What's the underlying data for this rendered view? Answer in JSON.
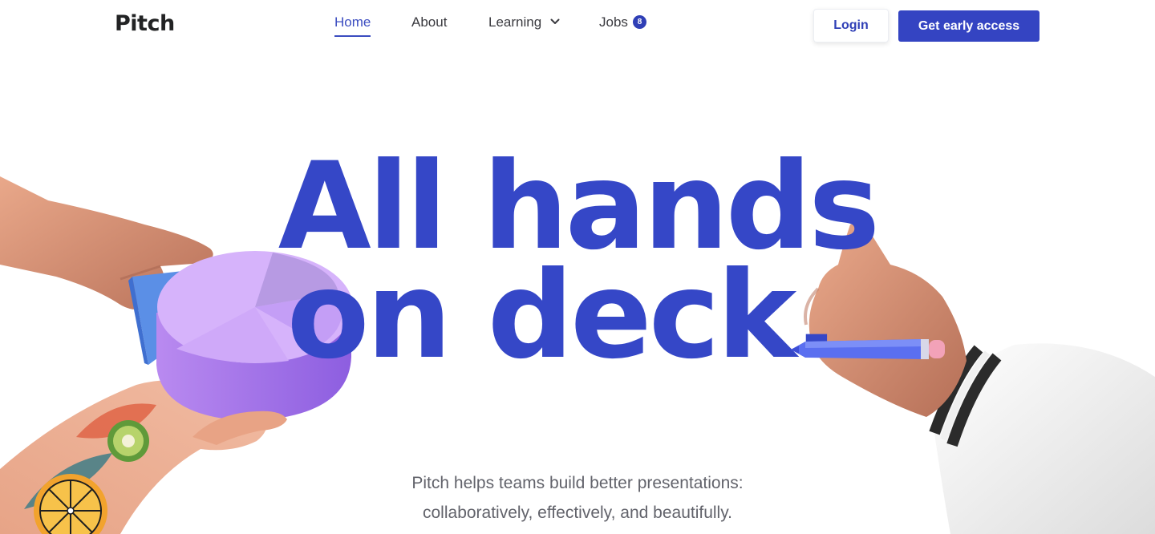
{
  "header": {
    "logo": "Pitch",
    "nav": [
      {
        "label": "Home",
        "active": true
      },
      {
        "label": "About",
        "active": false
      },
      {
        "label": "Learning",
        "active": false,
        "dropdown": true
      },
      {
        "label": "Jobs",
        "active": false,
        "badge": "8"
      }
    ],
    "login_label": "Login",
    "cta_label": "Get early access"
  },
  "hero": {
    "headline_line1": "All hands",
    "headline_line2": "on deck.",
    "subtitle_line1": "Pitch helps teams build better presentations:",
    "subtitle_line2": "collaboratively, effectively, and beautifully."
  },
  "colors": {
    "brand": "#3547c7",
    "button": "#3444c2",
    "text": "#222324",
    "muted": "#62636b"
  },
  "icons": [
    "chevron-down-icon"
  ]
}
